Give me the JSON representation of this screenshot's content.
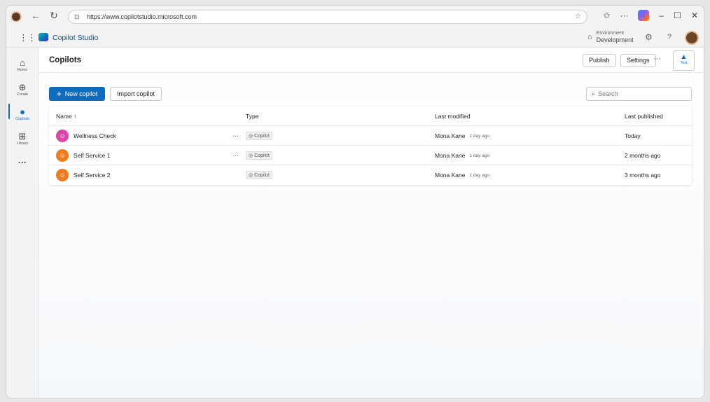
{
  "browser": {
    "url": "https://www.copilotstudio.microsoft.com"
  },
  "app": {
    "name": "Copilot Studio",
    "environment_label": "Environment",
    "environment_value": "Development"
  },
  "rail": {
    "items": [
      {
        "label": "Home",
        "icon": "home-icon"
      },
      {
        "label": "Create",
        "icon": "add-circle-icon"
      },
      {
        "label": "Copilots",
        "icon": "copilot-icon"
      },
      {
        "label": "Library",
        "icon": "library-icon"
      }
    ],
    "more": "···"
  },
  "page": {
    "title": "Copilots",
    "publish_label": "Publish",
    "settings_label": "Settings",
    "more_label": "···",
    "test_label": "Test",
    "new_label": "New copilot",
    "import_label": "Import copilot",
    "search_placeholder": "Search"
  },
  "table": {
    "columns": {
      "name": "Name ↑",
      "type": "Type",
      "modified": "Last modified",
      "published": "Last published"
    },
    "rows": [
      {
        "name": "Wellness Check",
        "type": "Copilot",
        "modified_by": "Mona Kane",
        "modified_time": "1 day ago",
        "published": "Today",
        "color": "#d946a8",
        "has_more": true
      },
      {
        "name": "Self Service 1",
        "type": "Copilot",
        "modified_by": "Mona Kane",
        "modified_time": "1 day ago",
        "published": "2 months ago",
        "color": "#f07b1e",
        "has_more": true
      },
      {
        "name": "Self Service 2",
        "type": "Copilot",
        "modified_by": "Mona Kane",
        "modified_time": "1 day ago",
        "published": "3 months ago",
        "color": "#f07b1e",
        "has_more": false
      }
    ]
  },
  "colors": {
    "accent": "#0f6cbd"
  }
}
